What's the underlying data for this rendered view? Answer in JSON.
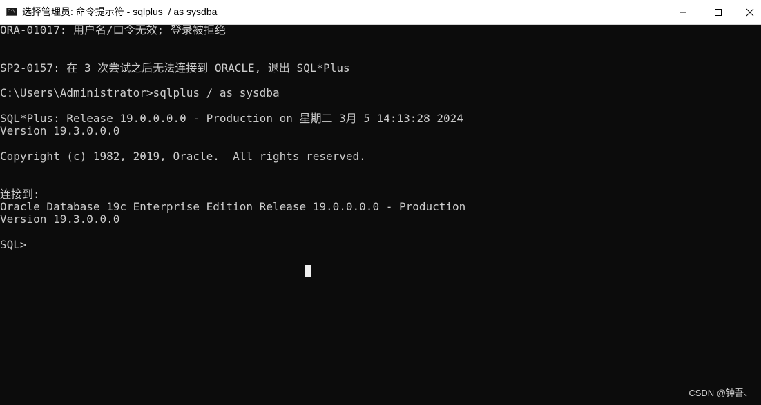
{
  "window": {
    "icon": "cmd-icon",
    "icon_text": "C:\\",
    "title": "选择管理员: 命令提示符 - sqlplus  / as sysdba"
  },
  "controls": {
    "minimize_icon": "minimize-icon",
    "maximize_icon": "maximize-icon",
    "close_icon": "close-icon"
  },
  "terminal": {
    "lines": [
      "ORA-01017: 用户名/口令无效; 登录被拒绝",
      "",
      "",
      "SP2-0157: 在 3 次尝试之后无法连接到 ORACLE, 退出 SQL*Plus",
      "",
      "C:\\Users\\Administrator>sqlplus / as sysdba",
      "",
      "SQL*Plus: Release 19.0.0.0.0 - Production on 星期二 3月 5 14:13:28 2024",
      "Version 19.3.0.0.0",
      "",
      "Copyright (c) 1982, 2019, Oracle.  All rights reserved.",
      "",
      "",
      "连接到:",
      "Oracle Database 19c Enterprise Edition Release 19.0.0.0.0 - Production",
      "Version 19.3.0.0.0",
      "",
      "SQL>"
    ]
  },
  "watermark": "CSDN @钟吾、"
}
